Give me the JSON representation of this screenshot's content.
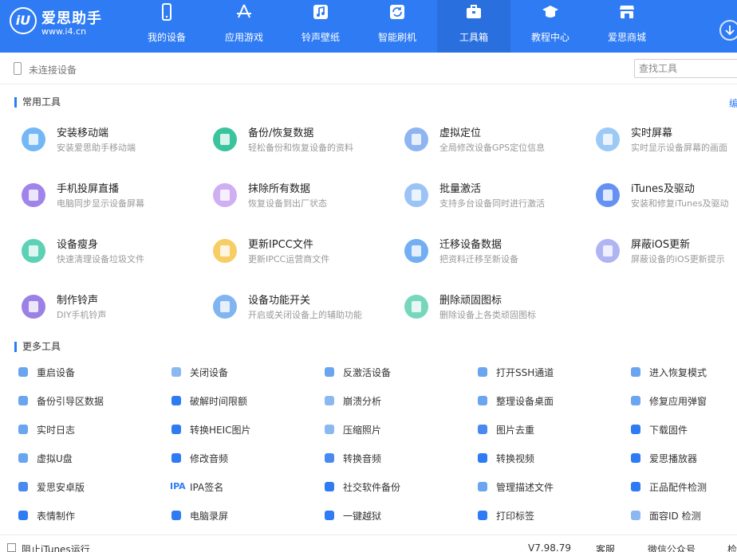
{
  "header": {
    "logo_text": "iU",
    "brand": "爱思助手",
    "site": "www.i4.cn",
    "nav": [
      {
        "label": "我的设备",
        "icon": "phone-icon"
      },
      {
        "label": "应用游戏",
        "icon": "app-store-icon"
      },
      {
        "label": "铃声壁纸",
        "icon": "music-note-icon"
      },
      {
        "label": "智能刷机",
        "icon": "refresh-icon"
      },
      {
        "label": "工具箱",
        "icon": "toolbox-icon",
        "active": true
      },
      {
        "label": "教程中心",
        "icon": "graduation-cap-icon"
      },
      {
        "label": "爱思商城",
        "icon": "shop-icon"
      }
    ]
  },
  "device": {
    "status": "未连接设备",
    "search_placeholder": "查找工具"
  },
  "common": {
    "title": "常用工具",
    "edit": "编",
    "tools": [
      {
        "title": "安装移动端",
        "desc": "安装爱思助手移动端",
        "icon": "i4-logo-icon",
        "color": "#5aaaf5"
      },
      {
        "title": "备份/恢复数据",
        "desc": "轻松备份和恢复设备的资料",
        "icon": "layers-icon",
        "color": "#19b98c"
      },
      {
        "title": "虚拟定位",
        "desc": "全局修改设备GPS定位信息",
        "icon": "location-pin-icon",
        "color": "#7aa8f0"
      },
      {
        "title": "实时屏幕",
        "desc": "实时显示设备屏幕的画面",
        "icon": "screens-icon",
        "color": "#8cc0f5"
      },
      {
        "title": "手机投屏直播",
        "desc": "电脑同步显示设备屏幕",
        "icon": "phone-cast-icon",
        "color": "#8f6ee8"
      },
      {
        "title": "抹除所有数据",
        "desc": "恢复设备到出厂状态",
        "icon": "eraser-icon",
        "color": "#c8a0f0"
      },
      {
        "title": "批量激活",
        "desc": "支持多台设备同时进行激活",
        "icon": "stack-icon",
        "color": "#8ab8f5"
      },
      {
        "title": "iTunes及驱动",
        "desc": "安装和修复iTunes及驱动",
        "icon": "itunes-icon",
        "color": "#4a7ff0"
      },
      {
        "title": "设备瘦身",
        "desc": "快速清理设备垃圾文件",
        "icon": "broom-icon",
        "color": "#3fc9a8"
      },
      {
        "title": "更新IPCC文件",
        "desc": "更新IPCC运营商文件",
        "icon": "folder-ipcc-icon",
        "color": "#f5c64a"
      },
      {
        "title": "迁移设备数据",
        "desc": "把资料迁移至新设备",
        "icon": "migrate-icon",
        "color": "#5aa0f0"
      },
      {
        "title": "屏蔽iOS更新",
        "desc": "屏蔽设备的iOS更新提示",
        "icon": "block-update-icon",
        "color": "#a0a8f0"
      },
      {
        "title": "制作铃声",
        "desc": "DIY手机铃声",
        "icon": "ringtone-icon",
        "color": "#8a6be0"
      },
      {
        "title": "设备功能开关",
        "desc": "开启或关闭设备上的辅助功能",
        "icon": "sliders-icon",
        "color": "#6aa8f0"
      },
      {
        "title": "删除顽固图标",
        "desc": "删除设备上各类顽固图标",
        "icon": "trash-icon",
        "color": "#5fd0b0"
      }
    ]
  },
  "more": {
    "title": "更多工具",
    "items": [
      {
        "label": "重启设备",
        "icon": "restart-icon",
        "color": "#6aa5f0"
      },
      {
        "label": "关闭设备",
        "icon": "power-icon",
        "color": "#8ab8f0"
      },
      {
        "label": "反激活设备",
        "icon": "deactivate-icon",
        "color": "#6aa5f0"
      },
      {
        "label": "打开SSH通道",
        "icon": "ssh-icon",
        "color": "#6aa5f0"
      },
      {
        "label": "进入恢复模式",
        "icon": "recovery-icon",
        "color": "#6aa5f0"
      },
      {
        "label": "备份引导区数据",
        "icon": "backup-boot-icon",
        "color": "#6aa5f0"
      },
      {
        "label": "破解时间限额",
        "icon": "clock-icon",
        "color": "#2f7bf4"
      },
      {
        "label": "崩溃分析",
        "icon": "crash-icon",
        "color": "#8ab8f0"
      },
      {
        "label": "整理设备桌面",
        "icon": "grid-icon",
        "color": "#6aa5f0"
      },
      {
        "label": "修复应用弹窗",
        "icon": "fix-popup-icon",
        "color": "#6aa5f0"
      },
      {
        "label": "实时日志",
        "icon": "log-icon",
        "color": "#6aa5f0"
      },
      {
        "label": "转换HEIC图片",
        "icon": "convert-image-icon",
        "color": "#2f7bf4"
      },
      {
        "label": "压缩照片",
        "icon": "photo-icon",
        "color": "#8ab8f0"
      },
      {
        "label": "图片去重",
        "icon": "dedup-icon",
        "color": "#4a8af0"
      },
      {
        "label": "下载固件",
        "icon": "firmware-icon",
        "color": "#2f7bf4"
      },
      {
        "label": "虚拟U盘",
        "icon": "usb-icon",
        "color": "#6aa5f0"
      },
      {
        "label": "修改音频",
        "icon": "audio-edit-icon",
        "color": "#2f7bf4"
      },
      {
        "label": "转换音频",
        "icon": "audio-convert-icon",
        "color": "#4a8af0"
      },
      {
        "label": "转换视频",
        "icon": "video-convert-icon",
        "color": "#2f7bf4"
      },
      {
        "label": "爱思播放器",
        "icon": "player-icon",
        "color": "#2f7bf4"
      },
      {
        "label": "爱思安卓版",
        "icon": "android-icon",
        "color": "#4a8af0"
      },
      {
        "label": "IPA签名",
        "icon": "ipa-icon",
        "color": "#2f7bf4",
        "text_icon": "IPA"
      },
      {
        "label": "社交软件备份",
        "icon": "social-backup-icon",
        "color": "#2f7bf4"
      },
      {
        "label": "管理描述文件",
        "icon": "profile-icon",
        "color": "#6aa5f0"
      },
      {
        "label": "正品配件检测",
        "icon": "accessory-icon",
        "color": "#2f7bf4"
      },
      {
        "label": "表情制作",
        "icon": "emoji-icon",
        "color": "#2f7bf4"
      },
      {
        "label": "电脑录屏",
        "icon": "record-icon",
        "color": "#2f7bf4"
      },
      {
        "label": "一键越狱",
        "icon": "unlock-icon",
        "color": "#2f7bf4"
      },
      {
        "label": "打印标签",
        "icon": "print-icon",
        "color": "#2f7bf4"
      },
      {
        "label": "面容ID 检测",
        "icon": "face-id-icon",
        "color": "#8ab8f0"
      }
    ]
  },
  "footer": {
    "itunes_block": "阻止iTunes运行",
    "version": "V7.98.79",
    "service": "客服",
    "wechat": "微信公众号",
    "more": "检"
  }
}
